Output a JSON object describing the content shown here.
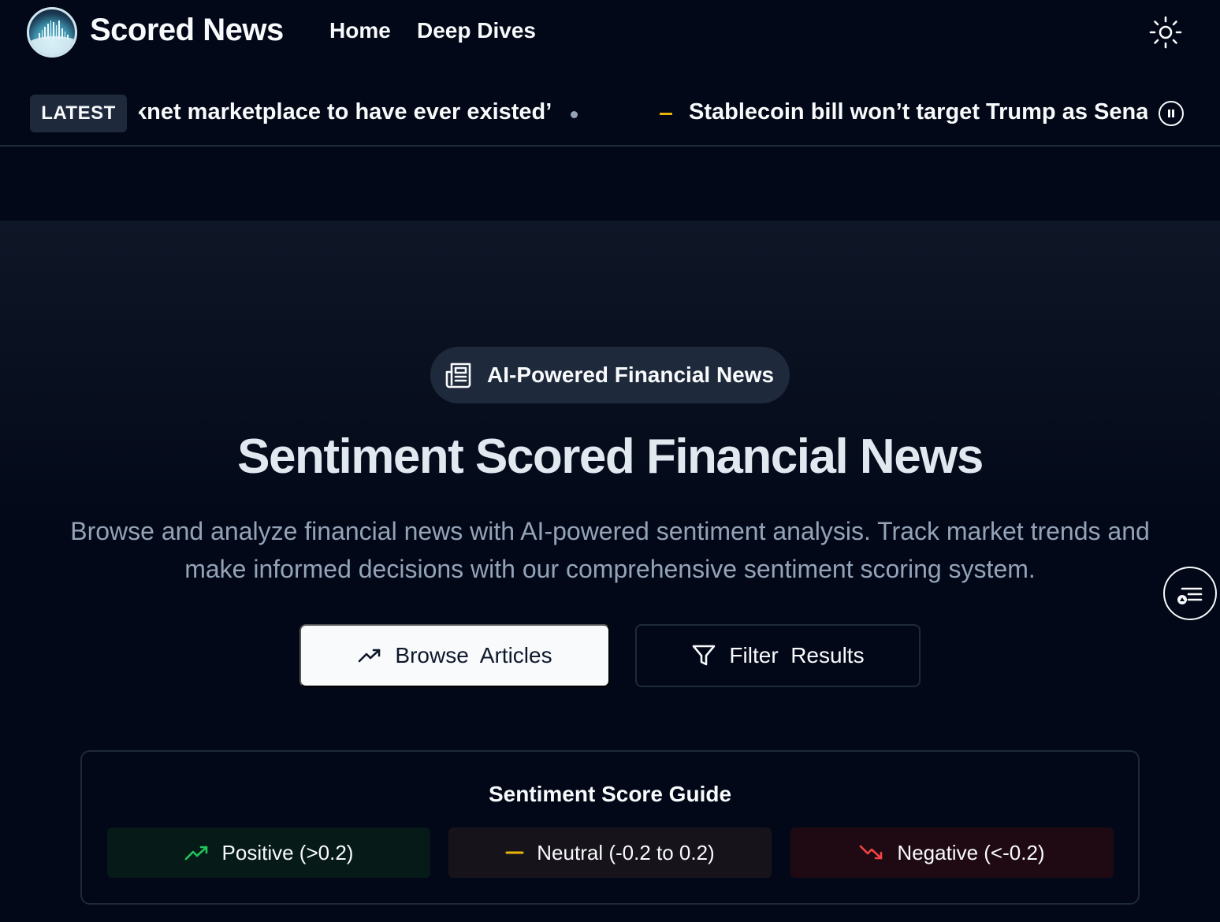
{
  "header": {
    "brand": "Scored News",
    "nav": {
      "home": "Home",
      "deep_dives": "Deep Dives"
    }
  },
  "ticker": {
    "badge": "LATEST",
    "items": [
      "knet marketplace to have ever existed’",
      "Stablecoin bill won’t target Trump as Senat"
    ]
  },
  "hero": {
    "pill": "AI-Powered Financial News",
    "title": "Sentiment Scored Financial News",
    "subtitle": "Browse and analyze financial news with AI-powered sentiment analysis. Track market trends and make informed decisions with our comprehensive sentiment scoring system.",
    "browse_button": "Browse  Articles",
    "filter_button": "Filter  Results"
  },
  "guide": {
    "title": "Sentiment Score Guide",
    "positive": "Positive (>0.2)",
    "neutral": "Neutral (-0.2 to 0.2)",
    "negative": "Negative (<-0.2)"
  },
  "colors": {
    "background": "#020817",
    "positive": "#22c55e",
    "neutral": "#eab308",
    "negative": "#ef4444"
  },
  "icons": {
    "theme": "sun-icon",
    "pill": "newspaper-icon",
    "browse": "trending-up-icon",
    "filter": "filter-icon",
    "pause": "pause-icon",
    "float": "list-filter-icon"
  }
}
